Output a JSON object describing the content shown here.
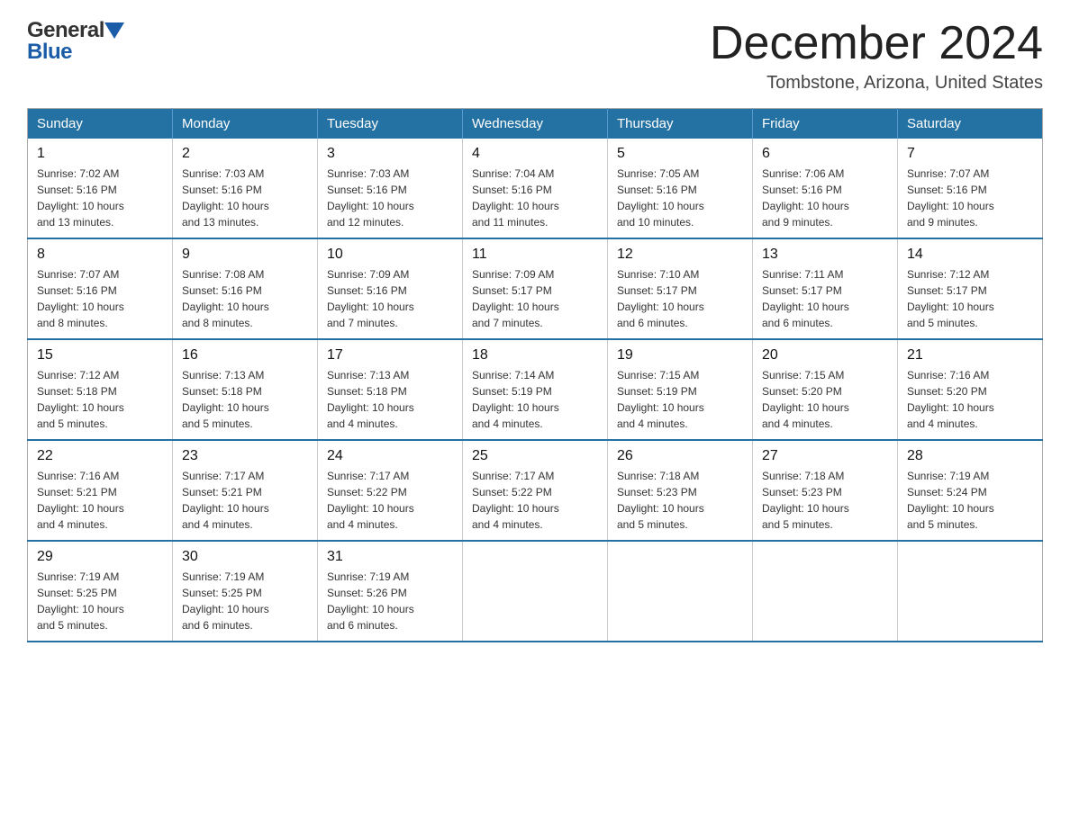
{
  "header": {
    "logo_general": "General",
    "logo_blue": "Blue",
    "month_title": "December 2024",
    "location": "Tombstone, Arizona, United States"
  },
  "weekdays": [
    "Sunday",
    "Monday",
    "Tuesday",
    "Wednesday",
    "Thursday",
    "Friday",
    "Saturday"
  ],
  "weeks": [
    [
      {
        "day": "1",
        "sunrise": "7:02 AM",
        "sunset": "5:16 PM",
        "daylight": "10 hours and 13 minutes."
      },
      {
        "day": "2",
        "sunrise": "7:03 AM",
        "sunset": "5:16 PM",
        "daylight": "10 hours and 13 minutes."
      },
      {
        "day": "3",
        "sunrise": "7:03 AM",
        "sunset": "5:16 PM",
        "daylight": "10 hours and 12 minutes."
      },
      {
        "day": "4",
        "sunrise": "7:04 AM",
        "sunset": "5:16 PM",
        "daylight": "10 hours and 11 minutes."
      },
      {
        "day": "5",
        "sunrise": "7:05 AM",
        "sunset": "5:16 PM",
        "daylight": "10 hours and 10 minutes."
      },
      {
        "day": "6",
        "sunrise": "7:06 AM",
        "sunset": "5:16 PM",
        "daylight": "10 hours and 9 minutes."
      },
      {
        "day": "7",
        "sunrise": "7:07 AM",
        "sunset": "5:16 PM",
        "daylight": "10 hours and 9 minutes."
      }
    ],
    [
      {
        "day": "8",
        "sunrise": "7:07 AM",
        "sunset": "5:16 PM",
        "daylight": "10 hours and 8 minutes."
      },
      {
        "day": "9",
        "sunrise": "7:08 AM",
        "sunset": "5:16 PM",
        "daylight": "10 hours and 8 minutes."
      },
      {
        "day": "10",
        "sunrise": "7:09 AM",
        "sunset": "5:16 PM",
        "daylight": "10 hours and 7 minutes."
      },
      {
        "day": "11",
        "sunrise": "7:09 AM",
        "sunset": "5:17 PM",
        "daylight": "10 hours and 7 minutes."
      },
      {
        "day": "12",
        "sunrise": "7:10 AM",
        "sunset": "5:17 PM",
        "daylight": "10 hours and 6 minutes."
      },
      {
        "day": "13",
        "sunrise": "7:11 AM",
        "sunset": "5:17 PM",
        "daylight": "10 hours and 6 minutes."
      },
      {
        "day": "14",
        "sunrise": "7:12 AM",
        "sunset": "5:17 PM",
        "daylight": "10 hours and 5 minutes."
      }
    ],
    [
      {
        "day": "15",
        "sunrise": "7:12 AM",
        "sunset": "5:18 PM",
        "daylight": "10 hours and 5 minutes."
      },
      {
        "day": "16",
        "sunrise": "7:13 AM",
        "sunset": "5:18 PM",
        "daylight": "10 hours and 5 minutes."
      },
      {
        "day": "17",
        "sunrise": "7:13 AM",
        "sunset": "5:18 PM",
        "daylight": "10 hours and 4 minutes."
      },
      {
        "day": "18",
        "sunrise": "7:14 AM",
        "sunset": "5:19 PM",
        "daylight": "10 hours and 4 minutes."
      },
      {
        "day": "19",
        "sunrise": "7:15 AM",
        "sunset": "5:19 PM",
        "daylight": "10 hours and 4 minutes."
      },
      {
        "day": "20",
        "sunrise": "7:15 AM",
        "sunset": "5:20 PM",
        "daylight": "10 hours and 4 minutes."
      },
      {
        "day": "21",
        "sunrise": "7:16 AM",
        "sunset": "5:20 PM",
        "daylight": "10 hours and 4 minutes."
      }
    ],
    [
      {
        "day": "22",
        "sunrise": "7:16 AM",
        "sunset": "5:21 PM",
        "daylight": "10 hours and 4 minutes."
      },
      {
        "day": "23",
        "sunrise": "7:17 AM",
        "sunset": "5:21 PM",
        "daylight": "10 hours and 4 minutes."
      },
      {
        "day": "24",
        "sunrise": "7:17 AM",
        "sunset": "5:22 PM",
        "daylight": "10 hours and 4 minutes."
      },
      {
        "day": "25",
        "sunrise": "7:17 AM",
        "sunset": "5:22 PM",
        "daylight": "10 hours and 4 minutes."
      },
      {
        "day": "26",
        "sunrise": "7:18 AM",
        "sunset": "5:23 PM",
        "daylight": "10 hours and 5 minutes."
      },
      {
        "day": "27",
        "sunrise": "7:18 AM",
        "sunset": "5:23 PM",
        "daylight": "10 hours and 5 minutes."
      },
      {
        "day": "28",
        "sunrise": "7:19 AM",
        "sunset": "5:24 PM",
        "daylight": "10 hours and 5 minutes."
      }
    ],
    [
      {
        "day": "29",
        "sunrise": "7:19 AM",
        "sunset": "5:25 PM",
        "daylight": "10 hours and 5 minutes."
      },
      {
        "day": "30",
        "sunrise": "7:19 AM",
        "sunset": "5:25 PM",
        "daylight": "10 hours and 6 minutes."
      },
      {
        "day": "31",
        "sunrise": "7:19 AM",
        "sunset": "5:26 PM",
        "daylight": "10 hours and 6 minutes."
      },
      null,
      null,
      null,
      null
    ]
  ],
  "labels": {
    "sunrise": "Sunrise:",
    "sunset": "Sunset:",
    "daylight": "Daylight:"
  }
}
